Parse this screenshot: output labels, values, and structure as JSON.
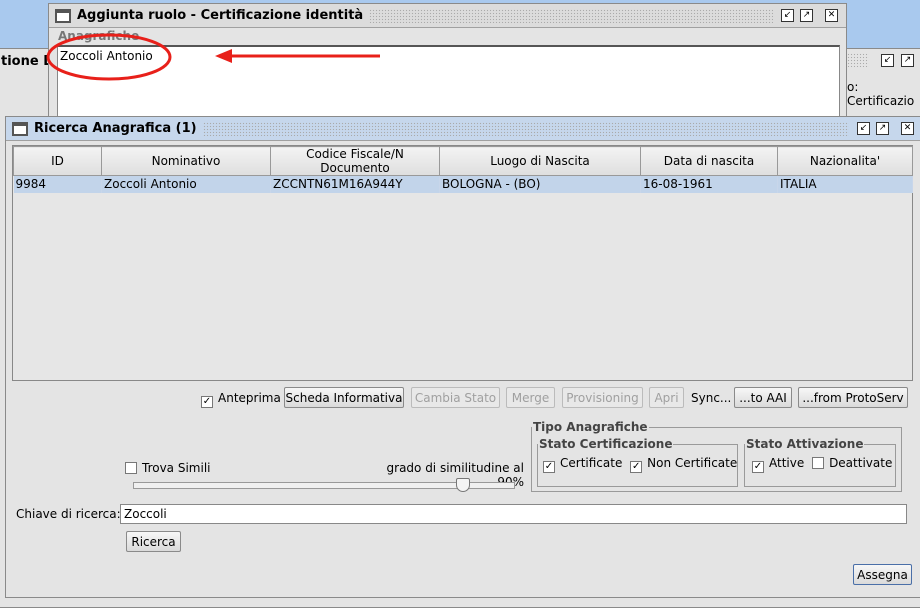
{
  "back_window": {
    "title_fragment": "tione D",
    "label_fragment": "o: Certificazio"
  },
  "dialog": {
    "title": "Aggiunta ruolo - Certificazione identità",
    "group_label": "Anagrafiche",
    "selected_person": "Zoccoli Antonio"
  },
  "annotation": {
    "color": "#e8201a",
    "shapes": [
      "ellipse",
      "arrow-left"
    ]
  },
  "search_window": {
    "title": "Ricerca Anagrafica (1)",
    "columns": [
      "ID",
      "Nominativo",
      "Codice Fiscale/N Documento",
      "Luogo di Nascita",
      "Data di nascita",
      "Nazionalita'"
    ],
    "rows": [
      [
        "9984",
        "Zoccoli Antonio",
        "ZCCNTN61M16A944Y",
        "BOLOGNA - (BO)",
        "16-08-1961",
        "ITALIA"
      ]
    ],
    "selected_row_color": "#c2d4ea",
    "preview_label": "Anteprima",
    "preview_checked": true,
    "buttons": {
      "scheda": "Scheda Informativa",
      "cambia": "Cambia Stato",
      "merge": "Merge",
      "provisioning": "Provisioning",
      "apri": "Apri",
      "sync_label": "Sync...",
      "to_aai": "...to AAI",
      "from_proto": "...from ProtoServ"
    },
    "tipo_anagrafiche": "Tipo Anagrafiche",
    "stato_certificazione": {
      "label": "Stato Certificazione",
      "certificate": "Certificate",
      "certificate_checked": true,
      "non_certificate": "Non Certificate",
      "non_certificate_checked": true
    },
    "stato_attivazione": {
      "label": "Stato Attivazione",
      "attive": "Attive",
      "attive_checked": true,
      "deattivate": "Deattivate",
      "deattivate_checked": false
    },
    "trova_simili": "Trova Simili",
    "trova_simili_checked": false,
    "similarity_label": "grado di similitudine al 90%",
    "similarity_value": 90,
    "search_key_label": "Chiave di ricerca:",
    "search_key_value": "Zoccoli",
    "search_button": "Ricerca",
    "assign_button": "Assegna"
  }
}
